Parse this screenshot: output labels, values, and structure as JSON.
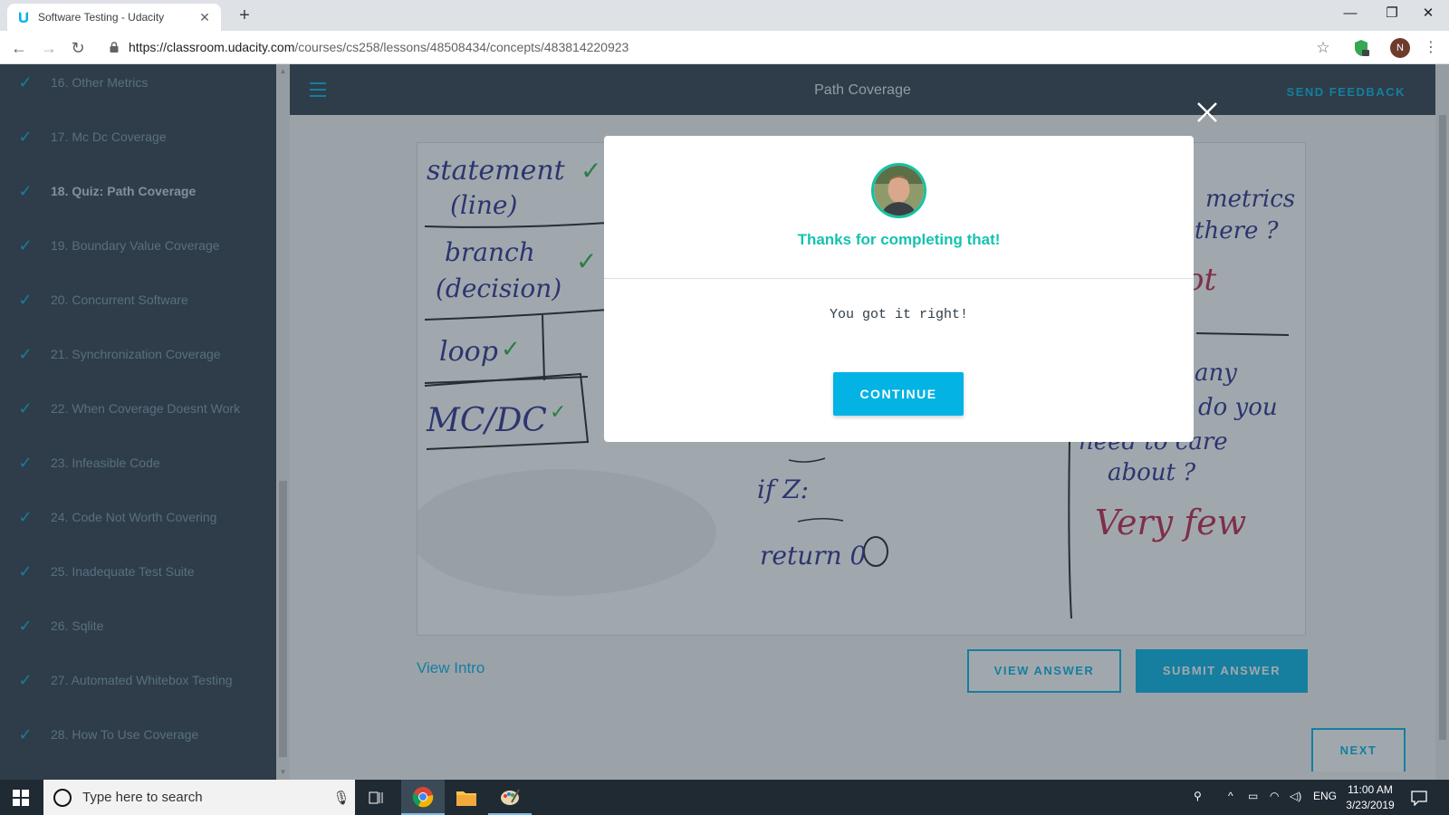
{
  "browser": {
    "tab_title": "Software Testing - Udacity",
    "url_host": "https://classroom.udacity.com",
    "url_path": "/courses/cs258/lessons/48508434/concepts/483814220923",
    "profile_initial": "N"
  },
  "sidebar": {
    "items": [
      {
        "label": "16. Other Metrics",
        "active": false
      },
      {
        "label": "17. Mc Dc Coverage",
        "active": false
      },
      {
        "label": "18. Quiz: Path Coverage",
        "active": true
      },
      {
        "label": "19. Boundary Value Coverage",
        "active": false
      },
      {
        "label": "20. Concurrent Software",
        "active": false
      },
      {
        "label": "21. Synchronization Coverage",
        "active": false
      },
      {
        "label": "22. When Coverage Doesnt Work",
        "active": false
      },
      {
        "label": "23. Infeasible Code",
        "active": false
      },
      {
        "label": "24. Code Not Worth Covering",
        "active": false
      },
      {
        "label": "25. Inadequate Test Suite",
        "active": false
      },
      {
        "label": "26. Sqlite",
        "active": false
      },
      {
        "label": "27. Automated Whitebox Testing",
        "active": false
      },
      {
        "label": "28. How To Use Coverage",
        "active": false
      }
    ]
  },
  "header": {
    "title": "Path Coverage",
    "feedback_label": "SEND FEEDBACK"
  },
  "whiteboard": {
    "left_cells": [
      "statement",
      "(line)",
      "branch",
      "(decision)",
      "loop",
      "MC/DC"
    ],
    "code": [
      "if Z:",
      "return 0"
    ],
    "right_lines": [
      "metrics",
      "there ?",
      "ot",
      "any",
      "do you",
      "need to care",
      "about ?"
    ],
    "answer": "Very few"
  },
  "actions": {
    "view_intro": "View Intro",
    "view_answer": "VIEW ANSWER",
    "submit_answer": "SUBMIT ANSWER",
    "next": "NEXT"
  },
  "modal": {
    "heading": "Thanks for completing that!",
    "message": "You got it right!",
    "continue_label": "CONTINUE"
  },
  "taskbar": {
    "search_placeholder": "Type here to search",
    "language": "ENG",
    "time": "11:00 AM",
    "date": "3/23/2019"
  },
  "colors": {
    "accent": "#02b3e4",
    "sidebar_bg": "#2e3d49",
    "success": "#15c2b1"
  }
}
